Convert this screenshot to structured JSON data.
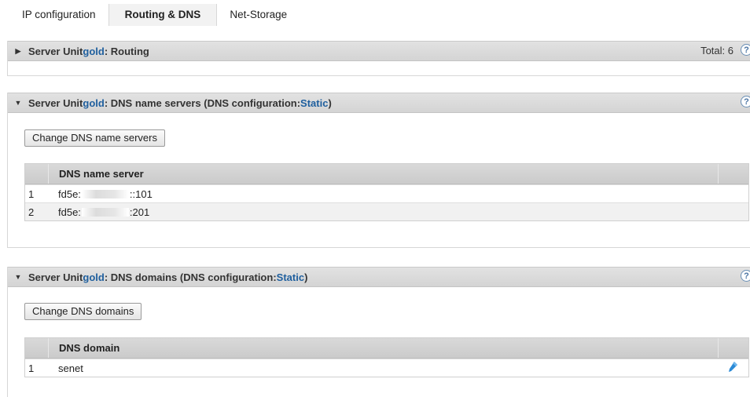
{
  "tabs": [
    {
      "label": "IP configuration"
    },
    {
      "label": "Routing & DNS"
    },
    {
      "label": "Net-Storage"
    }
  ],
  "routing": {
    "prefix": "Server Unit ",
    "unit": "gold",
    "suffix": ": Routing",
    "total": "Total: 6"
  },
  "dns_servers": {
    "prefix": "Server Unit ",
    "unit": "gold",
    "middle": ": DNS name servers (DNS configuration: ",
    "mode": "Static",
    "close": ")",
    "button": "Change DNS name servers",
    "column": "DNS name server",
    "rows": [
      {
        "num": "1",
        "prefix": "fd5e:",
        "suffix": "::101"
      },
      {
        "num": "2",
        "prefix": "fd5e:",
        "suffix": ":201"
      }
    ]
  },
  "dns_domains": {
    "prefix": "Server Unit ",
    "unit": "gold",
    "middle": ": DNS domains (DNS configuration: ",
    "mode": "Static",
    "close": ")",
    "button": "Change DNS domains",
    "column": "DNS domain",
    "rows": [
      {
        "num": "1",
        "value": "senet"
      }
    ]
  },
  "help_symbol": "?",
  "icons": {
    "collapsed": "triangle-right-icon",
    "expanded": "triangle-down-icon",
    "help": "help-icon",
    "edit": "edit-icon"
  }
}
